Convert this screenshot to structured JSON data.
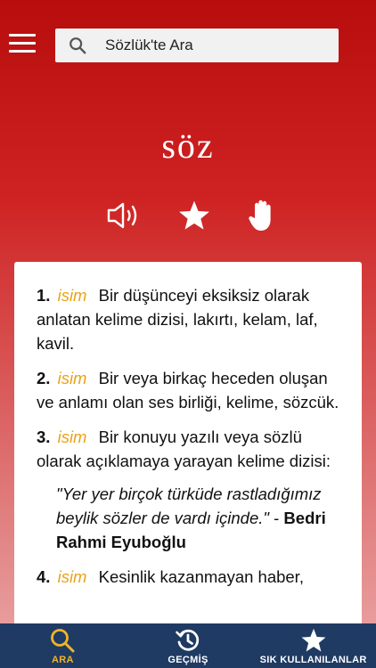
{
  "search": {
    "placeholder": "Sözlük'te Ara"
  },
  "word": "söz",
  "actions": [
    {
      "icon": "speaker-icon"
    },
    {
      "icon": "star-icon"
    },
    {
      "icon": "hand-icon"
    }
  ],
  "definitions": [
    {
      "num": "1.",
      "pos": "isim",
      "text": "Bir düşünceyi eksiksiz olarak anlatan kelime dizisi, lakırtı, kelam, laf, kavil."
    },
    {
      "num": "2.",
      "pos": "isim",
      "text": "Bir veya birkaç heceden oluşan ve anlamı olan ses birliği, kelime, sözcük."
    },
    {
      "num": "3.",
      "pos": "isim",
      "text": "Bir konuyu yazılı veya sözlü olarak açıklamaya yarayan kelime dizisi:",
      "quote": "\"Yer yer birçok türküde rastladığımız beylik sözler de vardı içinde.\"",
      "quote_sep": " - ",
      "author": "Bedri Rahmi Eyuboğlu"
    },
    {
      "num": "4.",
      "pos": "isim",
      "text": "Kesinlik kazanmayan haber,"
    }
  ],
  "tabs": [
    {
      "label": "ARA",
      "icon": "search-icon",
      "active": true
    },
    {
      "label": "GEÇMİŞ",
      "icon": "history-icon",
      "active": false
    },
    {
      "label": "SIK KULLANILANLAR",
      "icon": "star-icon",
      "active": false
    }
  ],
  "colors": {
    "header_red": "#b80d0d",
    "tabbar": "#1f3b63",
    "accent": "#f0b429",
    "pos": "#e8a317"
  }
}
